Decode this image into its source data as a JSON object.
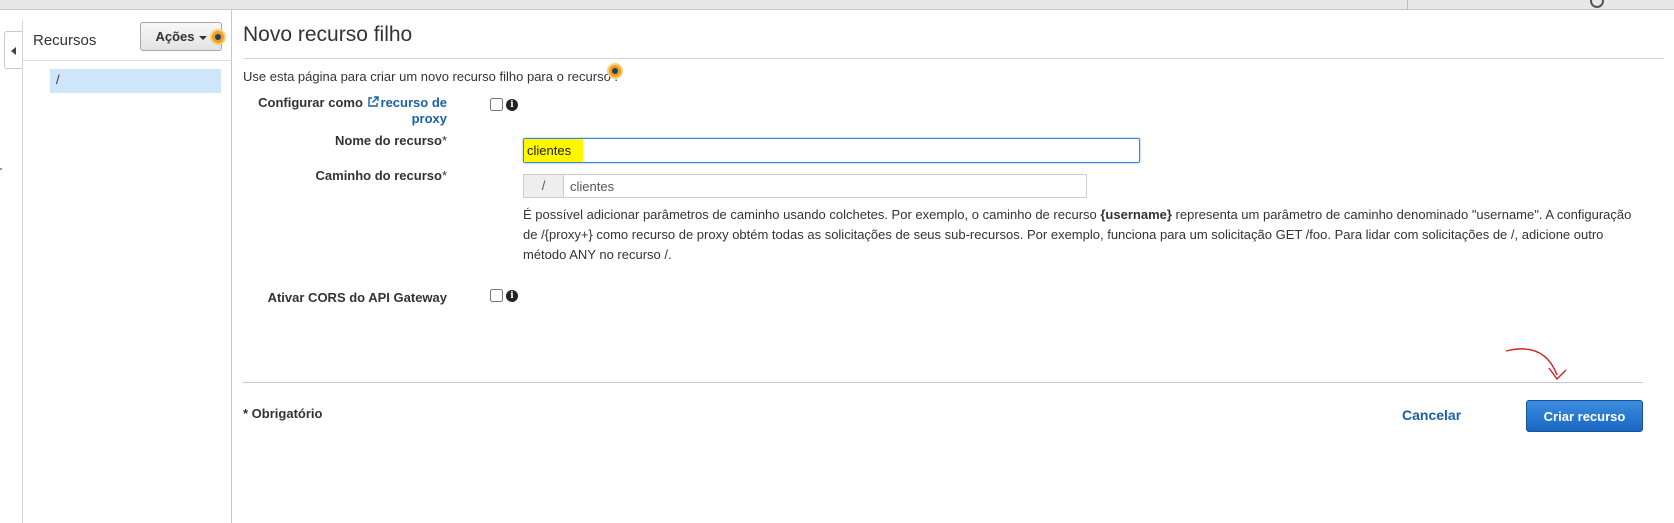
{
  "sidebar": {
    "title": "Recursos",
    "actions_label": "Ações",
    "tree_root": "/"
  },
  "page": {
    "title": "Novo recurso filho",
    "intro": "Use esta página para criar um novo recurso filho para o recurso ."
  },
  "form": {
    "proxy": {
      "label_prefix": "Configurar como",
      "link_text": "recurso de proxy",
      "checked": false
    },
    "resource_name": {
      "label": "Nome do recurso",
      "required_mark": "*",
      "value": "clientes"
    },
    "resource_path": {
      "label": "Caminho do recurso",
      "required_mark": "*",
      "prefix": "/",
      "value": "clientes"
    },
    "help": {
      "part1": "É possível adicionar parâmetros de caminho usando colchetes. Por exemplo, o caminho de recurso ",
      "param": "{username}",
      "part2": " representa um parâmetro de caminho denominado \"username\". A configuração de /{proxy+} como recurso de proxy obtém todas as solicitações de seus sub-recursos. Por exemplo, funciona para um solicitação GET /foo. Para lidar com solicitações de /, adicione outro método ANY no recurso /."
    },
    "cors": {
      "label": "Ativar CORS do API Gateway",
      "checked": false
    }
  },
  "footer": {
    "required_note": "* Obrigatório",
    "cancel_label": "Cancelar",
    "create_label": "Criar recurso"
  },
  "colors": {
    "primary": "#1966c2",
    "link": "#1a60a8",
    "highlight": "#fff700",
    "annotation": "#d42020"
  }
}
